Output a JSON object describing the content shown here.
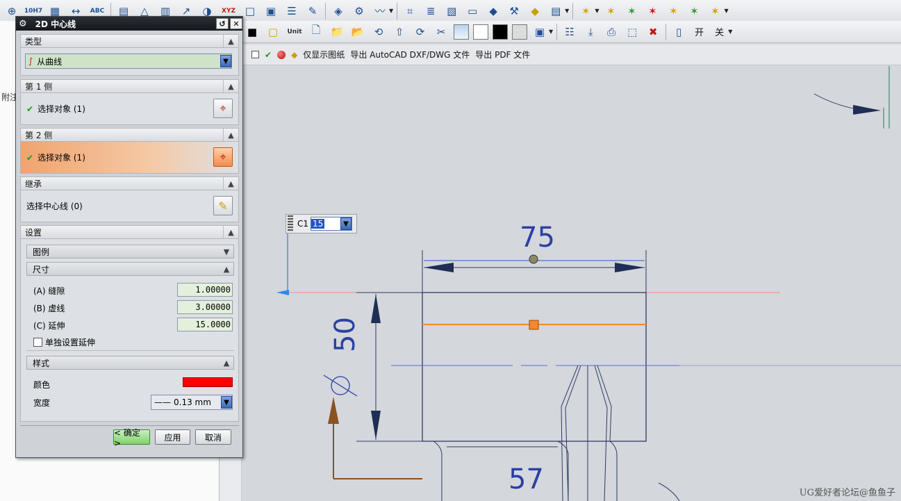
{
  "colors": {
    "accent_orange": "#f28c4a",
    "color_swatch": "#ff0000",
    "dim_blue": "#2c3fa5",
    "centerline": "#f08a2c"
  },
  "toolbar_top": {
    "icons": [
      "glasses-icon",
      "glasses-10h7-icon",
      "table-icon",
      "x-dim-icon",
      "abc-dim-icon",
      "grid-icon",
      "triangle-icon",
      "table-a-icon",
      "arrow-a-icon",
      "target-icon",
      "xyz-icon",
      "blank-icon",
      "doc-icon",
      "doc-lines-icon",
      "brush-icon",
      "layers-icon",
      "gear-icon",
      "wave-icon",
      "mesh-icon",
      "stack-icon",
      "sheet-icon",
      "paper-icon",
      "cube-icon",
      "hammer-icon",
      "yellow-cube-icon",
      "abc-box-icon",
      "sparkle-icon",
      "sparkle2-icon",
      "sparkle3-icon",
      "sparkle4-icon",
      "sparkle5-icon",
      "sparkle6-icon",
      "sparkle7-icon"
    ],
    "labels": {
      "tenh7": "10H7",
      "abc": "ABC",
      "xyz": "XYZ"
    }
  },
  "toolbar_second": {
    "unit_label": "Unit",
    "on_label": "开",
    "off_label": "关"
  },
  "command_bar": {
    "show_drawing_only": "仅显示图纸",
    "export_dxf": "导出 AutoCAD DXF/DWG 文件",
    "export_pdf": "导出 PDF 文件"
  },
  "left_panel": {
    "tab_label": "附注"
  },
  "dialog": {
    "title": "2D 中心线",
    "type": {
      "header": "类型",
      "value": "从曲线"
    },
    "side1": {
      "header": "第 1 侧",
      "select_label": "选择对象 (1)"
    },
    "side2": {
      "header": "第 2 侧",
      "select_label": "选择对象 (1)"
    },
    "inherit": {
      "header": "继承",
      "select_label": "选择中心线 (0)"
    },
    "settings": {
      "header": "设置",
      "legend_header": "图例",
      "size_header": "尺寸",
      "gap_label": "(A) 缝隙",
      "gap_value": "1.00000",
      "dash_label": "(B) 虚线",
      "dash_value": "3.00000",
      "ext_label": "(C) 延伸",
      "ext_value": "15.0000",
      "individual_ext_label": "单独设置延伸",
      "style_header": "样式",
      "color_label": "颜色",
      "width_label": "宽度",
      "width_value": "0.13 mm"
    },
    "buttons": {
      "ok": "< 确定 >",
      "apply": "应用",
      "cancel": "取消"
    }
  },
  "onscreen_input": {
    "label": "C1",
    "value": "15"
  },
  "drawing": {
    "dim_top": "75",
    "dim_diameter": "50",
    "dim_bottom": "57"
  },
  "watermark": "UG爱好者论坛@鱼鱼子"
}
